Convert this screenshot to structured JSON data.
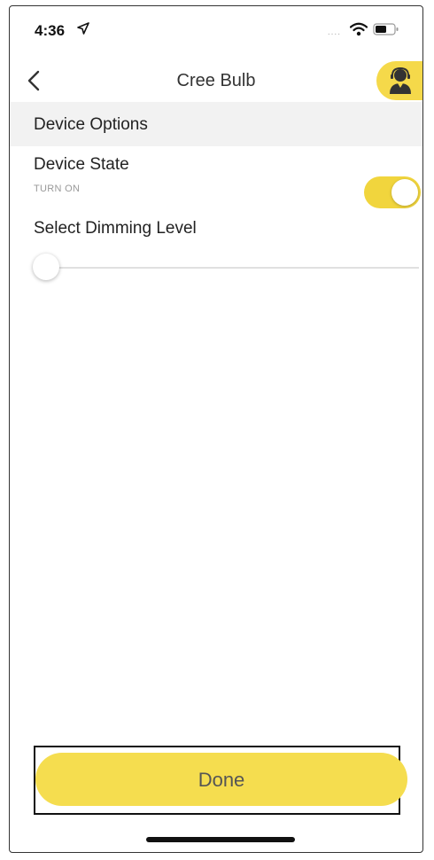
{
  "status_bar": {
    "time": "4:36",
    "signal_indicator": "....",
    "icons": [
      "location-arrow-icon",
      "wifi-icon",
      "battery-icon"
    ]
  },
  "nav": {
    "title": "Cree Bulb",
    "back_icon": "chevron-left-icon",
    "support_icon": "support-agent-icon"
  },
  "section": {
    "header": "Device Options"
  },
  "device_state": {
    "label": "Device State",
    "sublabel": "TURN ON",
    "toggle_on": true
  },
  "dimming": {
    "label": "Select Dimming Level",
    "level": 0
  },
  "footer": {
    "done_label": "Done"
  },
  "colors": {
    "accent": "#f5dd4f",
    "toggle": "#f1d53d",
    "section_bg": "#f2f2f2"
  }
}
